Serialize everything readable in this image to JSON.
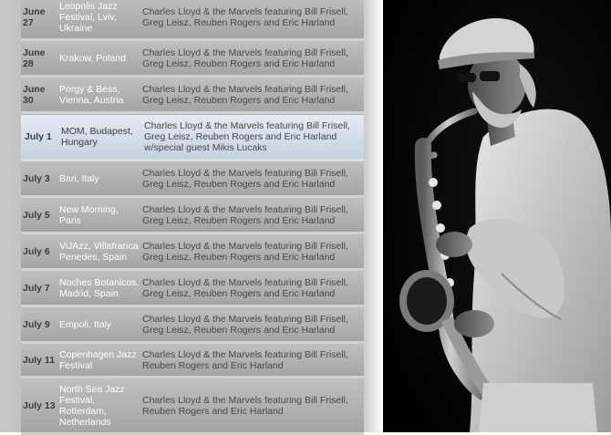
{
  "tour": {
    "rows": [
      {
        "date": "June 27",
        "venue": "Leopolis Jazz Festival, Lviv, Ukraine",
        "lineup": "Charles Lloyd & the Marvels featuring Bill Frisell, Greg Leisz, Reuben Rogers and Eric Harland"
      },
      {
        "date": "June 28",
        "venue": "Krakow, Poland",
        "lineup": "Charles Lloyd & the Marvels featuring Bill Frisell, Greg Leisz, Reuben Rogers and Eric Harland"
      },
      {
        "date": "June 30",
        "venue": "Porgy & Bess, Vienna, Austria",
        "lineup": "Charles Lloyd & the Marvels featuring Bill Frisell, Greg Leisz, Reuben Rogers and Eric Harland"
      },
      {
        "date": "July 1",
        "venue": "MOM, Budapest, Hungary",
        "lineup": "Charles Lloyd & the Marvels featuring Bill Frisell, Greg Leisz, Reuben Rogers and Eric Harland w/special guest Mikis Lucaks"
      },
      {
        "date": "July 3",
        "venue": "Bari, Italy",
        "lineup": "Charles Lloyd & the Marvels featuring Bill Frisell, Greg Leisz, Reuben Rogers and Eric Harland"
      },
      {
        "date": "July 5",
        "venue": "New Morning, Paris",
        "lineup": "Charles Lloyd & the Marvels featuring Bill Frisell, Greg Leisz, Reuben Rogers and Eric Harland"
      },
      {
        "date": "July 6",
        "venue": "ViJAzz, Villafranca Penedes, Spain",
        "lineup": "Charles Lloyd & the Marvels featuring Bill Frisell, Greg Leisz, Reuben Rogers and Eric Harland"
      },
      {
        "date": "July 7",
        "venue": "Noches Botanicos, Madrid, Spain",
        "lineup": "Charles Lloyd & the Marvels featuring Bill Frisell, Greg Leisz, Reuben Rogers and Eric Harland"
      },
      {
        "date": "July 9",
        "venue": "Empoli, Italy",
        "lineup": "Charles Lloyd & the Marvels featuring Bill Frisell, Greg Leisz, Reuben Rogers and Eric Harland"
      },
      {
        "date": "July 11",
        "venue": "Copenhagen Jazz Festival",
        "lineup": "Charles Lloyd & the Marvels featuring Bill Frisell, Reuben Rogers and Eric Harland"
      },
      {
        "date": "July 13",
        "venue": "North Sea Jazz Festival, Rotterdam, Netherlands",
        "lineup": "Charles Lloyd & the Marvels featuring Bill Frisell, Reuben Rogers and Eric Harland"
      }
    ]
  },
  "photo": {
    "subject": "saxophonist-performing",
    "colors": {
      "background": "#050505",
      "shirt": "#d8d8d8",
      "sax": "#9a9a9a"
    }
  }
}
